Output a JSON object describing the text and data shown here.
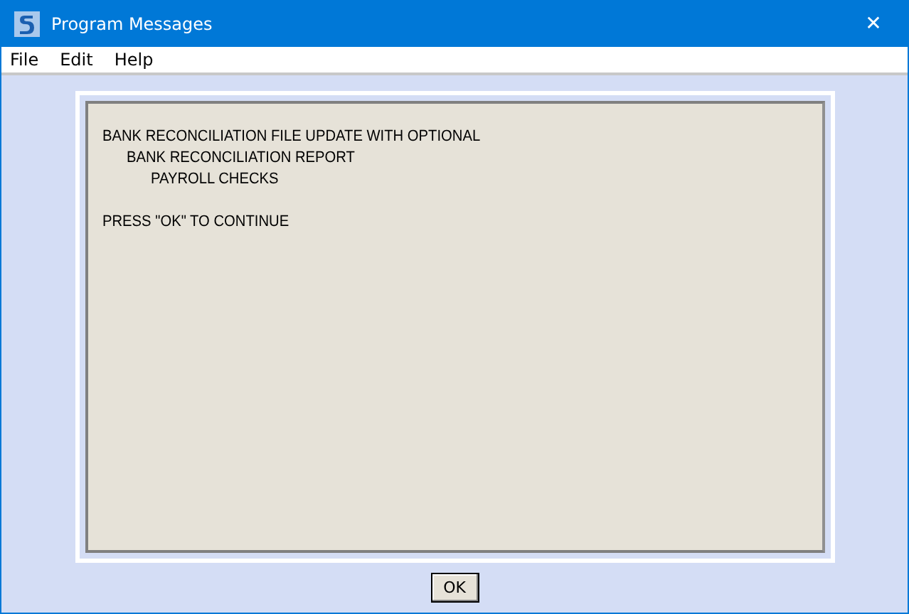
{
  "window": {
    "title": "Program Messages",
    "close": "✕"
  },
  "menu": [
    "File",
    "Edit",
    "Help"
  ],
  "message": {
    "lines": [
      {
        "text": "BANK RECONCILIATION FILE UPDATE WITH OPTIONAL",
        "children": [
          {
            "text": "BANK RECONCILIATION REPORT",
            "children": [
              {
                "text": "PAYROLL CHECKS"
              }
            ]
          }
        ]
      },
      {
        "text": "PRESS \"OK\" TO CONTINUE"
      }
    ]
  },
  "buttons": [
    "OK"
  ]
}
